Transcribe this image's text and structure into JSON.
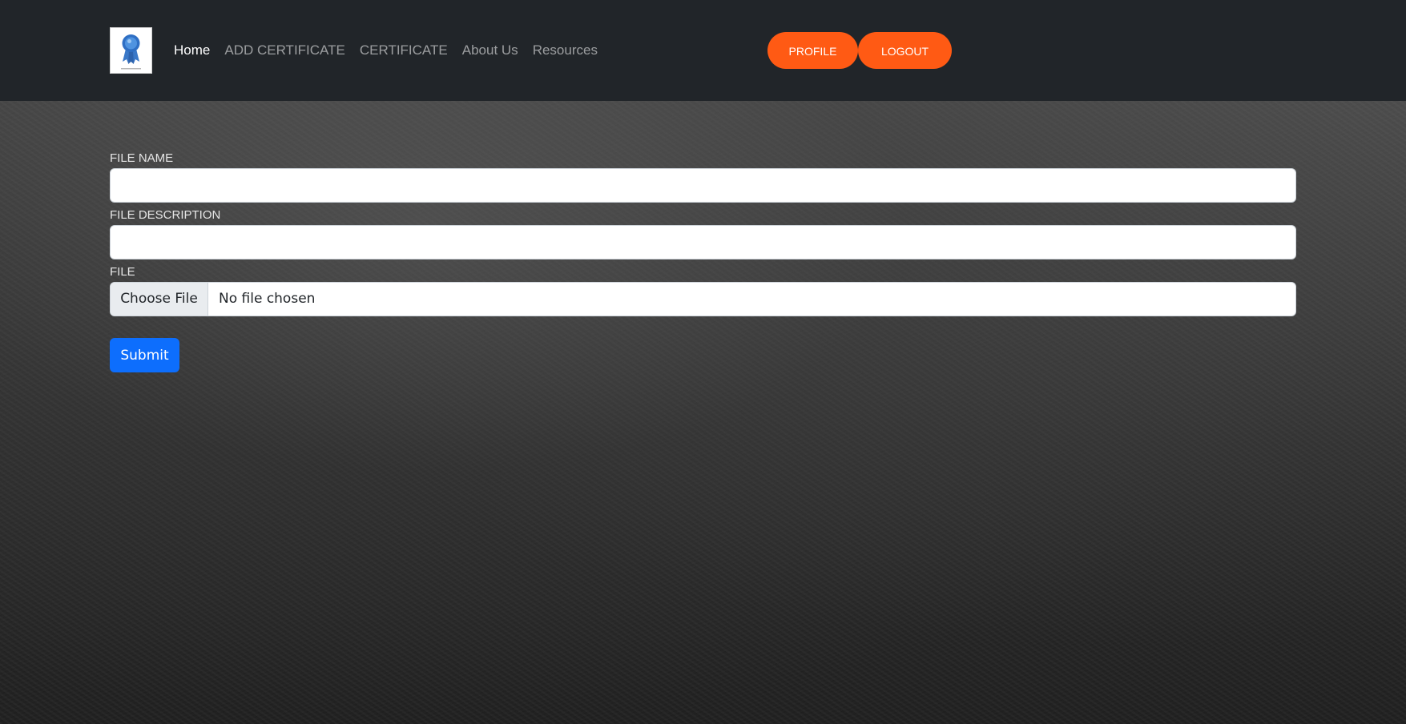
{
  "navbar": {
    "logo_icon": "certificate-ribbon-icon",
    "links": [
      {
        "label": "Home",
        "active": true
      },
      {
        "label": "ADD CERTIFICATE",
        "active": false
      },
      {
        "label": "CERTIFICATE",
        "active": false
      },
      {
        "label": "About Us",
        "active": false
      },
      {
        "label": "Resources",
        "active": false
      }
    ],
    "profile_label": "PROFILE",
    "logout_label": "LOGOUT"
  },
  "form": {
    "file_name_label": "FILE NAME",
    "file_name_value": "",
    "file_description_label": "FILE DESCRIPTION",
    "file_description_value": "",
    "file_label": "FILE",
    "choose_file_label": "Choose File",
    "file_status": "No file chosen",
    "submit_label": "Submit"
  },
  "colors": {
    "navbar_bg": "#212529",
    "accent_orange": "#ff5a14",
    "submit_blue": "#0d6efd"
  }
}
